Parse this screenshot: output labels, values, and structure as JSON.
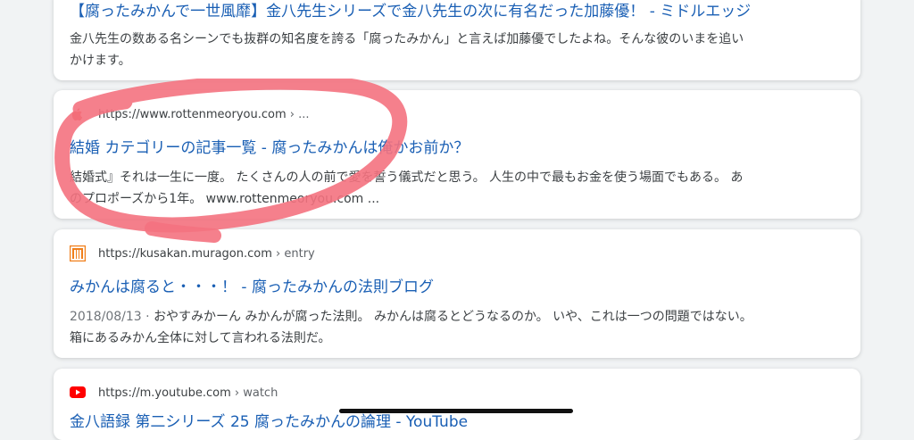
{
  "results": [
    {
      "title": "【腐ったみかんで一世風靡】金八先生シリーズで金八先生の次に有名だった加藤優！ - ミドルエッジ",
      "snippet_line1": "金八先生の数ある名シーンでも抜群の知名度を誇る「腐ったみかん」と言えば加藤優でしたよね。そんな彼のいまを追い",
      "snippet_line2": "かけます。"
    },
    {
      "favicon": "apple-icon",
      "url": "https://www.rottenmeoryou.com",
      "path": " › ...",
      "title": "結婚 カテゴリーの記事一覧 - 腐ったみかんは俺かお前か？",
      "snippet_line1": "結婚式』それは一生に一度。 たくさんの人の前で愛を誓う儀式だと思う。 人生の中で最もお金を使う場面でもある。 あ",
      "snippet_line2": "のプロポーズから1年。 www.rottenmeoryou.com ..."
    },
    {
      "favicon": "muragon-icon",
      "url": "https://kusakan.muragon.com",
      "path": " › entry",
      "title": "みかんは腐ると・・・！ - 腐ったみかんの法則ブログ",
      "date": "2018/08/13",
      "date_sep": " · ",
      "snippet_line1": "おやすみかーん みかんが腐った法則。 みかんは腐るとどうなるのか。 いや、これは一つの問題ではない。",
      "snippet_line2": "箱にあるみかん全体に対して言われる法則だ。"
    },
    {
      "favicon": "youtube-icon",
      "url": "https://m.youtube.com",
      "path": " › watch",
      "title": "金八語録 第二シリーズ 25 腐ったみかんの論理 - YouTube"
    }
  ],
  "colors": {
    "link": "#1a5fb4",
    "highlight": "#f4727f"
  }
}
